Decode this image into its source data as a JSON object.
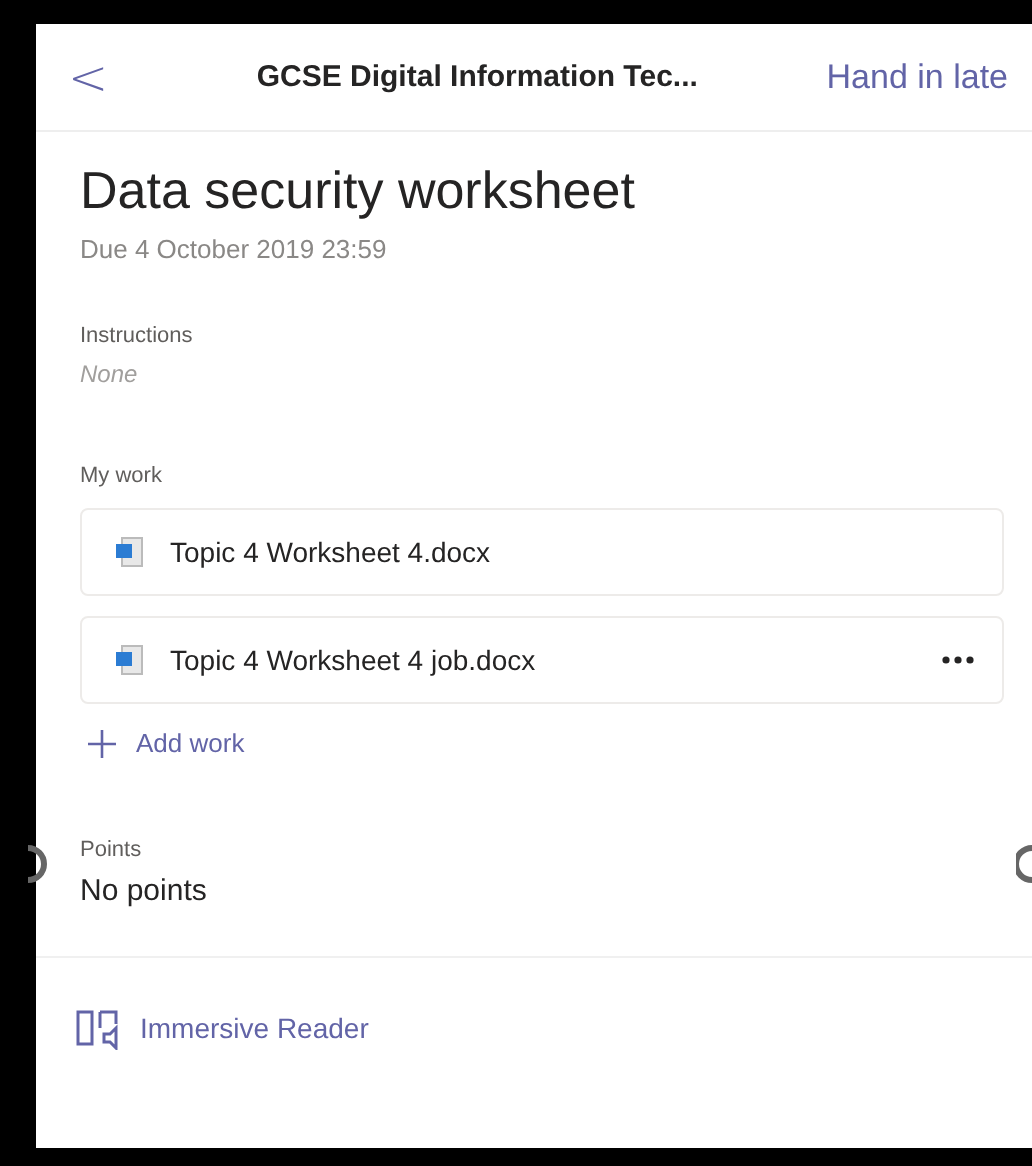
{
  "header": {
    "back": "<",
    "course": "GCSE Digital Information Tec...",
    "action": "Hand in late"
  },
  "assignment": {
    "title": "Data security worksheet",
    "due": "Due 4 October 2019 23:59"
  },
  "instructions": {
    "label": "Instructions",
    "value": "None"
  },
  "my_work": {
    "label": "My work",
    "files": [
      {
        "name": "Topic 4 Worksheet 4.docx",
        "has_menu": false
      },
      {
        "name": "Topic 4 Worksheet 4 job.docx",
        "has_menu": true
      }
    ],
    "add": "Add work"
  },
  "points": {
    "label": "Points",
    "value": "No points"
  },
  "footer": {
    "reader": "Immersive Reader"
  }
}
